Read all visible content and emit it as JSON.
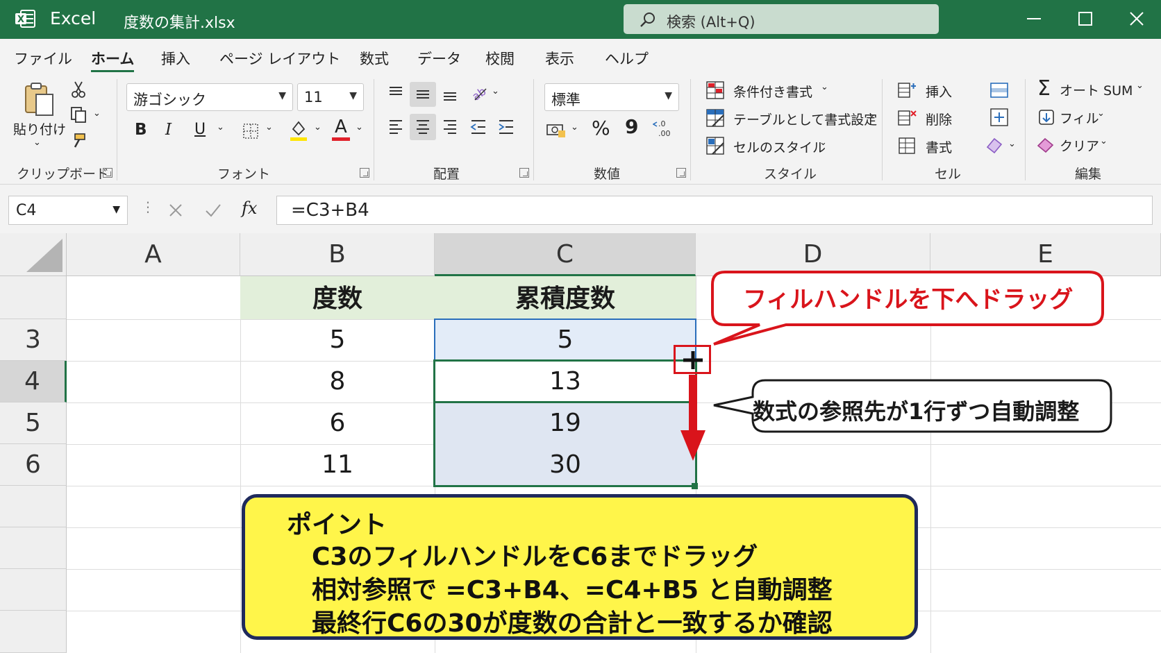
{
  "window": {
    "app_name": "Excel",
    "file_name": "度数の集計.xlsx",
    "search_placeholder": "検索 (Alt+Q)",
    "accent": "#217346"
  },
  "tabs": [
    "ファイル",
    "ホーム",
    "挿入",
    "ページ レイアウト",
    "数式",
    "データ",
    "校閲",
    "表示",
    "ヘルプ"
  ],
  "active_tab": "ホーム",
  "ribbon": {
    "clipboard": {
      "paste": "貼り付け",
      "label": "クリップボード"
    },
    "font": {
      "name": "游ゴシック",
      "size": "11",
      "bold": "B",
      "italic": "I",
      "underline": "U",
      "font_color_glyph": "A",
      "label": "フォント"
    },
    "alignment": {
      "label": "配置"
    },
    "number": {
      "format": "標準",
      "percent": "%",
      "comma": "9",
      "label": "数値"
    },
    "styles": {
      "conditional": "条件付き書式",
      "table": "テーブルとして書式設定",
      "cell_style": "セルのスタイル",
      "label": "スタイル"
    },
    "cells": {
      "insert": "挿入",
      "delete": "削除",
      "format": "書式",
      "label": "セル"
    },
    "editing": {
      "autosum": "オート SUM",
      "fill": "フィル",
      "clear": "クリア",
      "label": "編集"
    }
  },
  "formula_bar": {
    "name_box": "C4",
    "fx": "fx",
    "formula": "=C3+B4"
  },
  "sheet": {
    "columns": [
      "A",
      "B",
      "C",
      "D",
      "E"
    ],
    "selected_column": "C",
    "rows": [
      "",
      "3",
      "4",
      "5",
      "6",
      "",
      "",
      "",
      ""
    ],
    "selected_row": "4",
    "header_row": {
      "B": "度数",
      "C": "累積度数"
    },
    "data": [
      {
        "row": "3",
        "B": "5",
        "C": "5"
      },
      {
        "row": "4",
        "B": "8",
        "C": "13"
      },
      {
        "row": "5",
        "B": "6",
        "C": "19"
      },
      {
        "row": "6",
        "B": "11",
        "C": "30"
      }
    ]
  },
  "annotations": {
    "fill_handle_callout": "フィルハンドルを下へドラッグ",
    "auto_adjust_callout": "数式の参照先が1行ずつ自動調整",
    "point": {
      "title": "ポイント",
      "lines": [
        "C3のフィルハンドルをC6までドラッグ",
        "相対参照で =C3+B4、=C4+B5 と自動調整",
        "最終行C6の30が度数の合計と一致するか確認"
      ]
    },
    "red": "#d9141b",
    "navy": "#1f2a5c"
  }
}
